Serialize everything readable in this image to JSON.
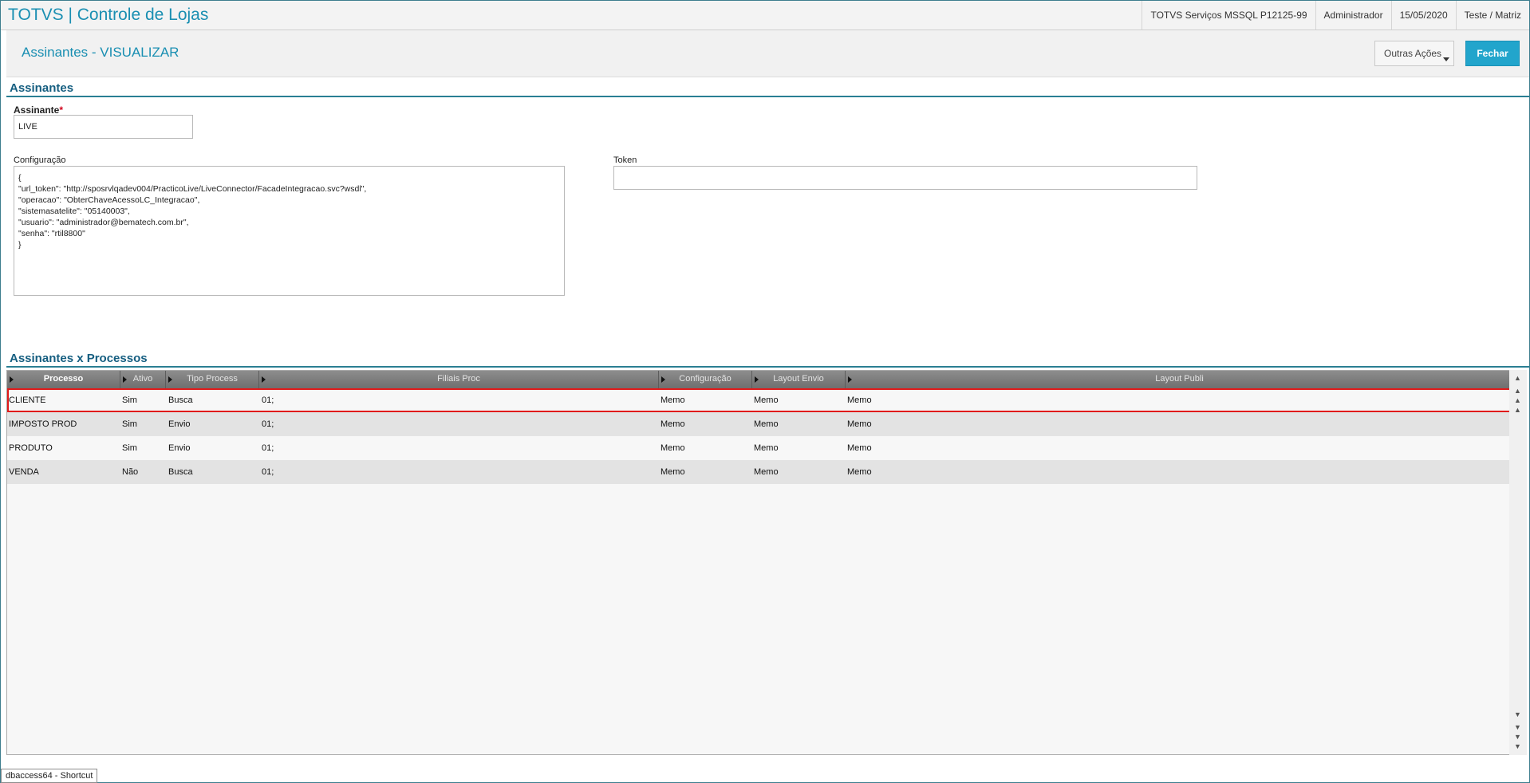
{
  "app": {
    "title": "TOTVS | Controle de Lojas",
    "environment": "TOTVS Serviços MSSQL P12125-99",
    "user": "Administrador",
    "date": "15/05/2020",
    "company": "Teste / Matriz"
  },
  "page": {
    "title": "Assinantes - VISUALIZAR",
    "actions": {
      "outras_label": "Outras Ações",
      "fechar_label": "Fechar"
    }
  },
  "form": {
    "section_title": "Assinantes",
    "assinante": {
      "label": "Assinante",
      "required_mark": "*",
      "value": "LIVE"
    },
    "configuracao": {
      "label": "Configuração",
      "value": "{\n\"url_token\": \"http://sposrvlqadev004/PracticoLive/LiveConnector/FacadeIntegracao.svc?wsdl\",\n\"operacao\": \"ObterChaveAcessoLC_Integracao\",\n\"sistemasatelite\": \"05140003\",\n\"usuario\": \"administrador@bematech.com.br\",\n\"senha\": \"rtil8800\"\n}"
    },
    "token": {
      "label": "Token",
      "value": ""
    }
  },
  "grid": {
    "section_title": "Assinantes x Processos",
    "columns": [
      "Processo",
      "Ativo",
      "Tipo Process",
      "Filiais Proc",
      "Configuração",
      "Layout Envio",
      "Layout Publi"
    ],
    "rows": [
      {
        "processo": "CLIENTE",
        "ativo": "Sim",
        "tipo": "Busca",
        "filiais": "01;",
        "configuracao": "Memo",
        "layout_envio": "Memo",
        "layout_publi": "Memo",
        "selected": true
      },
      {
        "processo": "IMPOSTO PROD",
        "ativo": "Sim",
        "tipo": "Envio",
        "filiais": "01;",
        "configuracao": "Memo",
        "layout_envio": "Memo",
        "layout_publi": "Memo",
        "selected": false
      },
      {
        "processo": "PRODUTO",
        "ativo": "Sim",
        "tipo": "Envio",
        "filiais": "01;",
        "configuracao": "Memo",
        "layout_envio": "Memo",
        "layout_publi": "Memo",
        "selected": false
      },
      {
        "processo": "VENDA",
        "ativo": "Não",
        "tipo": "Busca",
        "filiais": "01;",
        "configuracao": "Memo",
        "layout_envio": "Memo",
        "layout_publi": "Memo",
        "selected": false
      }
    ]
  },
  "colors": {
    "accent": "#1a8fb2",
    "section": "#155e80",
    "button_primary": "#22a5cc",
    "selection_outline": "#e01a1a"
  },
  "taskbar": {
    "tooltip": "dbaccess64 - Shortcut"
  }
}
